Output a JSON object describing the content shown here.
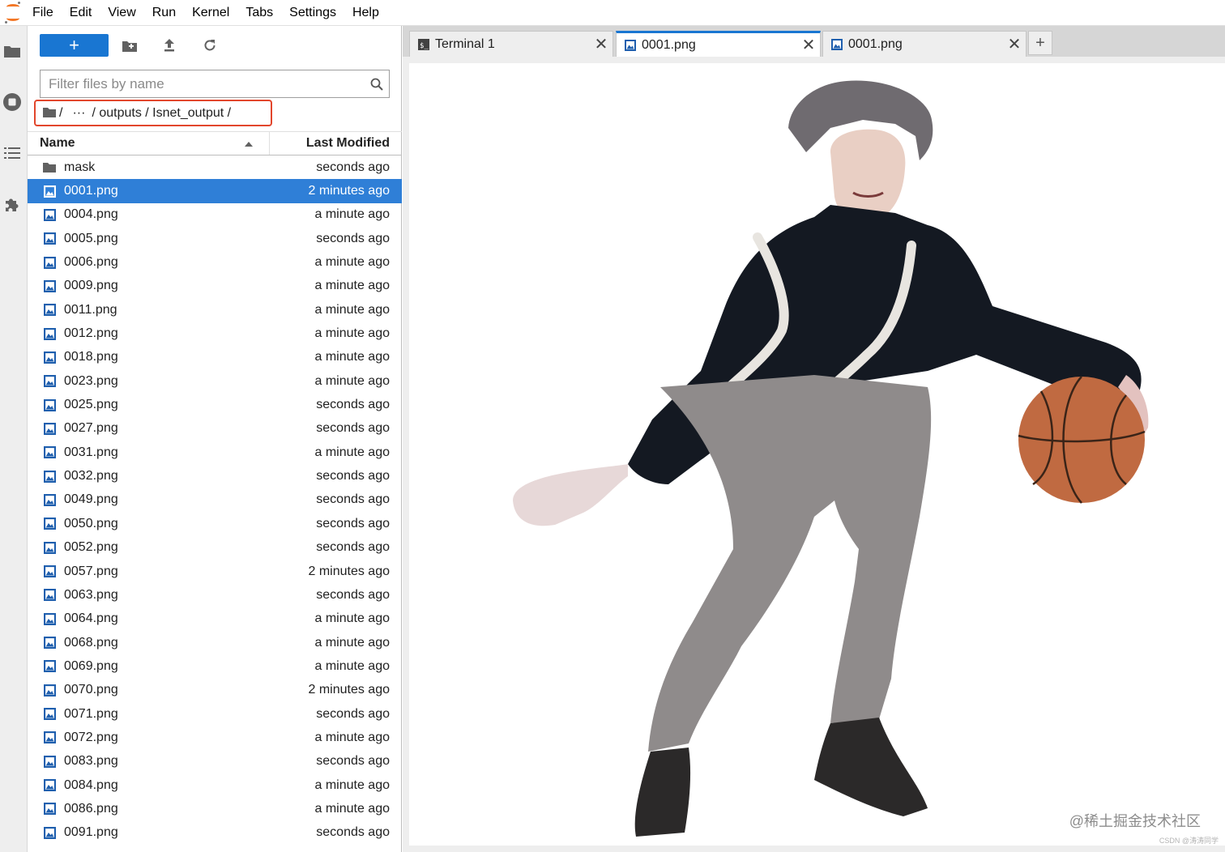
{
  "menubar": {
    "items": [
      "File",
      "Edit",
      "View",
      "Run",
      "Kernel",
      "Tabs",
      "Settings",
      "Help"
    ]
  },
  "activitybar": {
    "icons": [
      "folder-icon",
      "running-icon",
      "toc-icon",
      "extension-icon"
    ]
  },
  "filebrowser": {
    "new_launcher_label": "+",
    "filter_placeholder": "Filter files by name",
    "breadcrumb": {
      "root": "/",
      "ellipsis": "···",
      "path": "/ outputs / Isnet_output /"
    },
    "header": {
      "name": "Name",
      "modified": "Last Modified"
    },
    "files": [
      {
        "name": "mask",
        "modified": "seconds ago",
        "type": "folder"
      },
      {
        "name": "0001.png",
        "modified": "2 minutes ago",
        "type": "image",
        "selected": true
      },
      {
        "name": "0004.png",
        "modified": "a minute ago",
        "type": "image"
      },
      {
        "name": "0005.png",
        "modified": "seconds ago",
        "type": "image"
      },
      {
        "name": "0006.png",
        "modified": "a minute ago",
        "type": "image"
      },
      {
        "name": "0009.png",
        "modified": "a minute ago",
        "type": "image"
      },
      {
        "name": "0011.png",
        "modified": "a minute ago",
        "type": "image"
      },
      {
        "name": "0012.png",
        "modified": "a minute ago",
        "type": "image"
      },
      {
        "name": "0018.png",
        "modified": "a minute ago",
        "type": "image"
      },
      {
        "name": "0023.png",
        "modified": "a minute ago",
        "type": "image"
      },
      {
        "name": "0025.png",
        "modified": "seconds ago",
        "type": "image"
      },
      {
        "name": "0027.png",
        "modified": "seconds ago",
        "type": "image"
      },
      {
        "name": "0031.png",
        "modified": "a minute ago",
        "type": "image"
      },
      {
        "name": "0032.png",
        "modified": "seconds ago",
        "type": "image"
      },
      {
        "name": "0049.png",
        "modified": "seconds ago",
        "type": "image"
      },
      {
        "name": "0050.png",
        "modified": "seconds ago",
        "type": "image"
      },
      {
        "name": "0052.png",
        "modified": "seconds ago",
        "type": "image"
      },
      {
        "name": "0057.png",
        "modified": "2 minutes ago",
        "type": "image"
      },
      {
        "name": "0063.png",
        "modified": "seconds ago",
        "type": "image"
      },
      {
        "name": "0064.png",
        "modified": "a minute ago",
        "type": "image"
      },
      {
        "name": "0068.png",
        "modified": "a minute ago",
        "type": "image"
      },
      {
        "name": "0069.png",
        "modified": "a minute ago",
        "type": "image"
      },
      {
        "name": "0070.png",
        "modified": "2 minutes ago",
        "type": "image"
      },
      {
        "name": "0071.png",
        "modified": "seconds ago",
        "type": "image"
      },
      {
        "name": "0072.png",
        "modified": "a minute ago",
        "type": "image"
      },
      {
        "name": "0083.png",
        "modified": "seconds ago",
        "type": "image"
      },
      {
        "name": "0084.png",
        "modified": "a minute ago",
        "type": "image"
      },
      {
        "name": "0086.png",
        "modified": "a minute ago",
        "type": "image"
      },
      {
        "name": "0091.png",
        "modified": "seconds ago",
        "type": "image"
      }
    ]
  },
  "tabs": [
    {
      "label": "Terminal 1",
      "icon": "terminal-icon",
      "active": false
    },
    {
      "label": "0001.png",
      "icon": "image-icon",
      "active": true
    },
    {
      "label": "0001.png",
      "icon": "image-icon",
      "active": false
    }
  ],
  "add_tab_label": "+",
  "viewer": {
    "watermark": "@稀土掘金技术社区",
    "watermark_small": "CSDN @涛涛同学"
  },
  "colors": {
    "accent": "#1976d2",
    "selected_row": "#2f7fd7",
    "highlight_box": "#e2462c",
    "jupyter_orange": "#f37726"
  }
}
